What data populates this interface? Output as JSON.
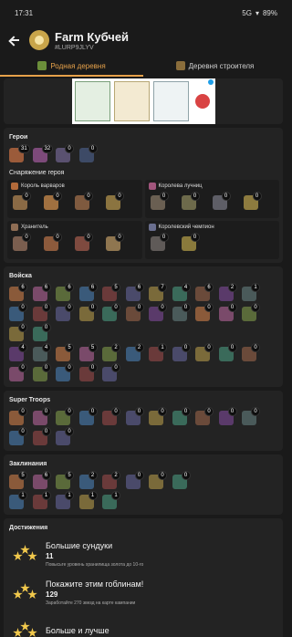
{
  "status": {
    "time": "17:31",
    "net": "5G",
    "battery": "89%"
  },
  "header": {
    "title": "Farm Кубчей",
    "tag": "#LURP9JLYV"
  },
  "tabs": [
    {
      "label": "Родная деревня",
      "active": true
    },
    {
      "label": "Деревня строителя",
      "active": false
    }
  ],
  "heroes": {
    "title": "Герои",
    "levels": [
      "31",
      "32",
      "0",
      "0"
    ]
  },
  "gear": {
    "title": "Снаряжение героя",
    "sets": [
      {
        "name": "Король варваров",
        "values": [
          "0",
          "0",
          "0",
          "0"
        ]
      },
      {
        "name": "Королева лучниц",
        "values": [
          "0",
          "0",
          "0",
          "0"
        ]
      },
      {
        "name": "Хранитель",
        "values": [
          "0",
          "0",
          "0",
          "0"
        ]
      },
      {
        "name": "Королевский чемпион",
        "values": [
          "0",
          "0"
        ]
      }
    ]
  },
  "troops": {
    "title": "Войска",
    "rows": [
      [
        "6",
        "6",
        "6",
        "6",
        "5",
        "6",
        "7",
        "4",
        "6",
        "2",
        "1"
      ],
      [
        "0",
        "0",
        "0",
        "0",
        "0",
        "0",
        "0",
        "0",
        "0",
        "0",
        "0"
      ],
      [
        "0",
        "0"
      ],
      [
        "4",
        "4",
        "5",
        "5",
        "2",
        "2",
        "1",
        "0",
        "0",
        "0",
        "0"
      ],
      [
        "0",
        "0",
        "0",
        "0",
        "0"
      ]
    ]
  },
  "super_troops": {
    "title": "Super Troops",
    "rows": [
      [
        "0",
        "0",
        "0",
        "0",
        "0",
        "0",
        "0",
        "0",
        "0",
        "0",
        "0"
      ],
      [
        "0",
        "0",
        "0"
      ]
    ]
  },
  "spells": {
    "title": "Заклинания",
    "rows": [
      [
        "5",
        "6",
        "5",
        "2",
        "2",
        "0",
        "0",
        "0"
      ],
      [
        "1",
        "1",
        "1",
        "1",
        "1"
      ]
    ]
  },
  "achievements": {
    "title": "Достижения",
    "items": [
      {
        "title": "Большие сундуки",
        "value": "11",
        "desc": "Повысьте уровень хранилища золота до 10-го"
      },
      {
        "title": "Покажите этим гоблинам!",
        "value": "129",
        "desc": "Заработайте 270 звезд на карте кампании"
      },
      {
        "title": "Больше и лучше",
        "value": "",
        "desc": ""
      }
    ]
  },
  "colors": {
    "accent": "#e6a14a",
    "bg": "#1a1a1a",
    "card": "#232323"
  }
}
